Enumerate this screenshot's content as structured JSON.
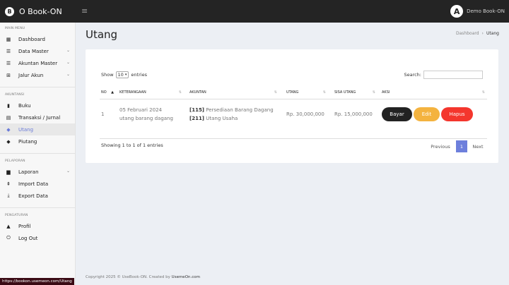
{
  "topbar": {
    "brand_logo": "B",
    "brand": "O Book-ON",
    "menu_icon": "≡",
    "user_avatar": "A",
    "user_name": "Demo Book-ON"
  },
  "sidebar": {
    "sections": [
      {
        "title": "MAIN MENU",
        "items": [
          {
            "label": "Dashboard",
            "icon": "dashboard-icon",
            "glyph": "▦",
            "chevron": false
          },
          {
            "label": "Data Master",
            "icon": "list-icon",
            "glyph": "☰",
            "chevron": true
          },
          {
            "label": "Akuntan Master",
            "icon": "list-icon",
            "glyph": "☰",
            "chevron": true
          },
          {
            "label": "Jalur Akun",
            "icon": "grid-icon",
            "glyph": "⊞",
            "chevron": true
          }
        ]
      },
      {
        "title": "AKUNTANSI",
        "items": [
          {
            "label": "Buku",
            "icon": "book-icon",
            "glyph": "▮",
            "chevron": false
          },
          {
            "label": "Transaksi / Jurnal",
            "icon": "journal-icon",
            "glyph": "▤",
            "chevron": false
          },
          {
            "label": "Utang",
            "icon": "tag-icon",
            "glyph": "◆",
            "chevron": false,
            "active": true
          },
          {
            "label": "Piutang",
            "icon": "tags-icon",
            "glyph": "◆",
            "chevron": false
          }
        ]
      },
      {
        "title": "PELAPORAN",
        "items": [
          {
            "label": "Laporan",
            "icon": "file-icon",
            "glyph": "▆",
            "chevron": true
          },
          {
            "label": "Import Data",
            "icon": "upload-icon",
            "glyph": "⇞",
            "chevron": false
          },
          {
            "label": "Export Data",
            "icon": "download-icon",
            "glyph": "⤓",
            "chevron": false
          }
        ]
      },
      {
        "title": "PENGATURAN",
        "items": [
          {
            "label": "Profil",
            "icon": "user-icon",
            "glyph": "▲",
            "chevron": false
          },
          {
            "label": "Log Out",
            "icon": "power-icon",
            "glyph": "⏻",
            "chevron": false
          }
        ]
      }
    ]
  },
  "page": {
    "title": "Utang",
    "breadcrumb_home": "Dashboard",
    "breadcrumb_sep": "›",
    "breadcrumb_current": "Utang"
  },
  "table": {
    "show_label": "Show",
    "show_value": "10",
    "entries_label": "entries",
    "search_label": "Search:",
    "search_value": "",
    "columns": [
      "NO",
      "KETERANGAAN",
      "AKUNTAN",
      "UTANG",
      "SISA UTANG",
      "AKSI"
    ],
    "rows": [
      {
        "no": "1",
        "ket_date": "05 Februari 2024",
        "ket_desc": "utang barang dagang",
        "akun1_code": "[115]",
        "akun1_name": "Persediaan Barang Dagang",
        "akun2_code": "[211]",
        "akun2_name": "Utang Usaha",
        "utang": "Rp. 30,000,000",
        "sisa": "Rp. 15,000,000"
      }
    ],
    "buttons": {
      "bayar": "Bayar",
      "edit": "Edit",
      "hapus": "Hapus"
    },
    "info": "Showing 1 to 1 of 1 entries",
    "pager": {
      "prev": "Previous",
      "current": "1",
      "next": "Next"
    }
  },
  "footer": {
    "text": "Copyright 2025 © UseBook-ON. Created by ",
    "author": "UsemeOn.com"
  },
  "statusbar": {
    "url": "https://bookon.usemeon.com/Utang"
  }
}
